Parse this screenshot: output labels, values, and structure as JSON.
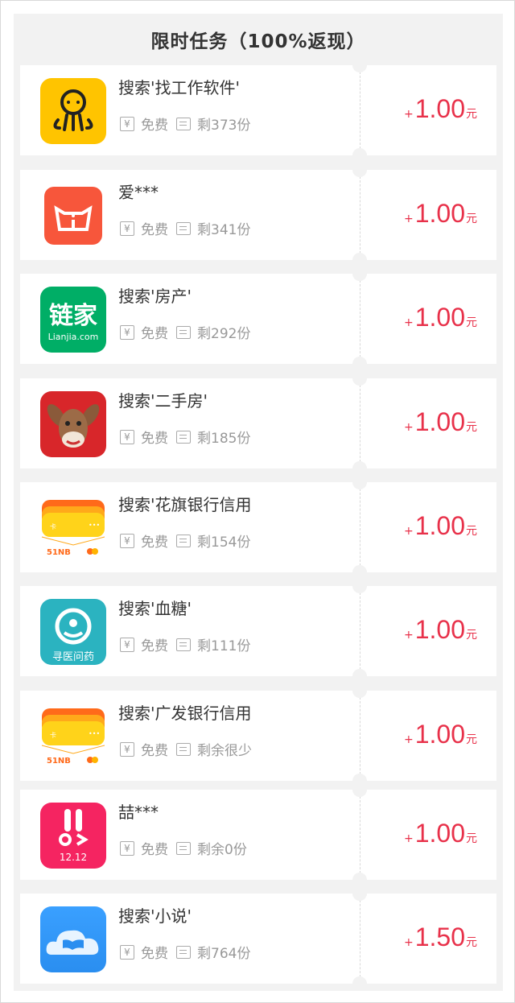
{
  "header": {
    "title": "限时任务（100%返现）"
  },
  "meta": {
    "free_label": "免费",
    "yuan_glyph": "¥"
  },
  "price": {
    "plus": "+",
    "unit": "元"
  },
  "tasks": [
    {
      "title": "搜索'找工作软件'",
      "remaining": "剩373份",
      "amount": "1.00",
      "icon": "octopus-app-icon",
      "color": "#ffc400"
    },
    {
      "title": "爱***",
      "remaining": "剩341份",
      "amount": "1.00",
      "icon": "pig-app-icon",
      "color": "#f7563b"
    },
    {
      "title": "搜索'房产'",
      "remaining": "剩292份",
      "amount": "1.00",
      "icon": "lianjia-app-icon",
      "color": "#00ae66",
      "icon_text": "链家",
      "icon_sub": "Lianjia.com"
    },
    {
      "title": "搜索'二手房'",
      "remaining": "剩185份",
      "amount": "1.00",
      "icon": "donkey-app-icon",
      "color": "#d8262a"
    },
    {
      "title": "搜索'花旗银行信用",
      "remaining": "剩154份",
      "amount": "1.00",
      "icon": "credit-card-app-icon",
      "color": "#ffd31a",
      "icon_sub": "51NB"
    },
    {
      "title": "搜索'血糖'",
      "remaining": "剩111份",
      "amount": "1.00",
      "icon": "doctor-app-icon",
      "color": "#2bb3c0",
      "icon_text": "寻医问药"
    },
    {
      "title": "搜索'广发银行信用",
      "remaining": "剩余很少",
      "amount": "1.00",
      "icon": "credit-card-app-icon",
      "color": "#ffd31a",
      "icon_sub": "51NB"
    },
    {
      "title": "喆***",
      "remaining": "剩余0份",
      "amount": "1.00",
      "icon": "rabbit-app-icon",
      "color": "#f52461",
      "icon_sub": "12.12"
    },
    {
      "title": "搜索'小说'",
      "remaining": "剩764份",
      "amount": "1.50",
      "icon": "book-cloud-app-icon",
      "color": "#2a8ef0"
    }
  ]
}
